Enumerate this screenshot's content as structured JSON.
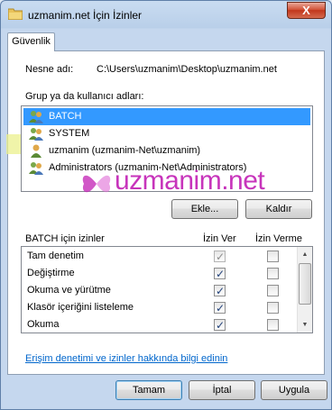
{
  "window": {
    "title": "uzmanim.net İçin İzinler",
    "close_label": "X"
  },
  "tab": {
    "label": "Güvenlik"
  },
  "object": {
    "label": "Nesne adı:",
    "value": "C:\\Users\\uzmanim\\Desktop\\uzmanim.net"
  },
  "groups": {
    "label": "Grup ya da kullanıcı adları:",
    "items": [
      {
        "label": "BATCH",
        "icon": "users-group-icon",
        "selected": true
      },
      {
        "label": "SYSTEM",
        "icon": "users-group-icon",
        "selected": false
      },
      {
        "label": "uzmanim (uzmanim-Net\\uzmanim)",
        "icon": "user-icon",
        "selected": false,
        "highlighted": true
      },
      {
        "label": "Administrators (uzmanim-Net\\Administrators)",
        "icon": "users-group-icon",
        "selected": false
      }
    ]
  },
  "buttons": {
    "add": "Ekle...",
    "remove": "Kaldır",
    "ok": "Tamam",
    "cancel": "İptal",
    "apply": "Uygula"
  },
  "permissions": {
    "label": "BATCH için izinler",
    "allow_header": "İzin Ver",
    "deny_header": "İzin Verme",
    "rows": [
      {
        "name": "Tam denetim",
        "allow": true,
        "allow_disabled": true,
        "deny": false
      },
      {
        "name": "Değiştirme",
        "allow": true,
        "allow_disabled": false,
        "deny": false
      },
      {
        "name": "Okuma ve yürütme",
        "allow": true,
        "allow_disabled": false,
        "deny": false
      },
      {
        "name": "Klasör içeriğini listeleme",
        "allow": true,
        "allow_disabled": false,
        "deny": false
      },
      {
        "name": "Okuma",
        "allow": true,
        "allow_disabled": false,
        "deny": false
      }
    ]
  },
  "help_link": "Erişim denetimi ve izinler hakkında bilgi edinin",
  "watermark": {
    "text": "uzmanim.net"
  },
  "colors": {
    "selection": "#3399ff",
    "highlight": "#ebf08c",
    "link": "#0066cc",
    "watermark": "#c21fb4"
  }
}
